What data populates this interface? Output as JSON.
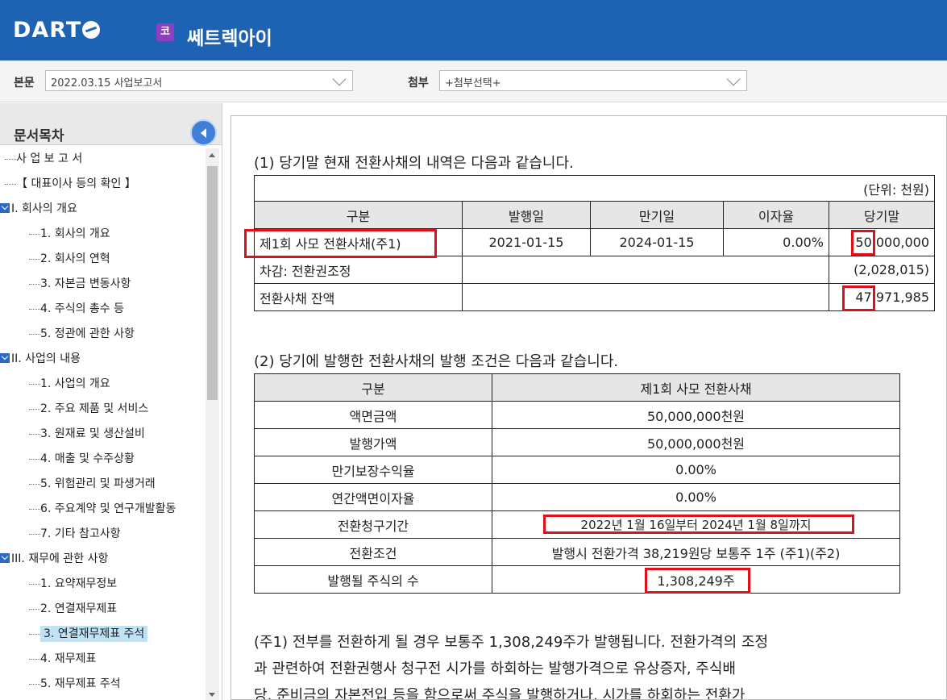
{
  "header": {
    "logo": "DART",
    "market_badge": "코",
    "company": "쎄트렉아이"
  },
  "selectors": {
    "main_label": "본문",
    "main_value": "2022.03.15  사업보고서",
    "attach_label": "첨부",
    "attach_value": "+첨부선택+"
  },
  "sidebar": {
    "title": "문서목차",
    "items": [
      {
        "label": "사 업 보 고 서",
        "level": 0
      },
      {
        "label": "【 대표이사 등의 확인 】",
        "level": 0
      },
      {
        "label": "I. 회사의 개요",
        "level": 0,
        "expanded": true
      },
      {
        "label": "1. 회사의 개요",
        "level": 1
      },
      {
        "label": "2. 회사의 연혁",
        "level": 1
      },
      {
        "label": "3. 자본금 변동사항",
        "level": 1
      },
      {
        "label": "4. 주식의 총수 등",
        "level": 1
      },
      {
        "label": "5. 정관에 관한 사항",
        "level": 1
      },
      {
        "label": "II. 사업의 내용",
        "level": 0,
        "expanded": true
      },
      {
        "label": "1. 사업의 개요",
        "level": 1
      },
      {
        "label": "2. 주요 제품 및 서비스",
        "level": 1
      },
      {
        "label": "3. 원재료 및 생산설비",
        "level": 1
      },
      {
        "label": "4. 매출 및 수주상황",
        "level": 1
      },
      {
        "label": "5. 위험관리 및 파생거래",
        "level": 1
      },
      {
        "label": "6. 주요계약 및 연구개발활동",
        "level": 1
      },
      {
        "label": "7. 기타 참고사항",
        "level": 1
      },
      {
        "label": "III. 재무에 관한 사항",
        "level": 0,
        "expanded": true
      },
      {
        "label": "1. 요약재무정보",
        "level": 1
      },
      {
        "label": "2. 연결재무제표",
        "level": 1
      },
      {
        "label": "3. 연결재무제표 주석",
        "level": 1,
        "selected": true
      },
      {
        "label": "4. 재무제표",
        "level": 1
      },
      {
        "label": "5. 재무제표 주석",
        "level": 1
      }
    ]
  },
  "doc": {
    "heading1": "(1) 당기말 현재 전환사채의 내역은 다음과 같습니다.",
    "table1": {
      "unit": "(단위: 천원)",
      "headers": [
        "구분",
        "발행일",
        "만기일",
        "이자율",
        "당기말"
      ],
      "row1": [
        "제1회 사모 전환사채(주1)",
        "2021-01-15",
        "2024-01-15",
        "0.00%",
        "50,000,000"
      ],
      "row2": [
        "차감: 전환권조정",
        "(2,028,015)"
      ],
      "row3": [
        "전환사채 잔액",
        "47,971,985"
      ]
    },
    "heading2": "(2) 당기에 발행한 전환사채의 발행 조건은 다음과 같습니다.",
    "table2": {
      "headers": [
        "구분",
        "제1회 사모  전환사채"
      ],
      "rows": [
        [
          "액면금액",
          "50,000,000천원"
        ],
        [
          "발행가액",
          "50,000,000천원"
        ],
        [
          "만기보장수익율",
          "0.00%"
        ],
        [
          "연간액면이자율",
          "0.00%"
        ],
        [
          "전환청구기간",
          "2022년 1월 16일부터 2024년 1월 8일까지"
        ],
        [
          "전환조건",
          "발행시 전환가격 38,219원당 보통주 1주 (주1)(주2)"
        ],
        [
          "발행될 주식의 수",
          "1,308,249주"
        ]
      ]
    },
    "note_lines": [
      "(주1) 전부를 전환하게 될 경우 보통주 1,308,249주가 발행됩니다. 전환가격의 조정",
      "과 관련하여 전환권행사 청구전 시가를 하회하는 발행가격으로 유상증자, 주식배",
      "당, 준비금의 자본전입 등을 함으로써 주식을 발행하거나, 시가를 하회하는 전환가"
    ]
  }
}
